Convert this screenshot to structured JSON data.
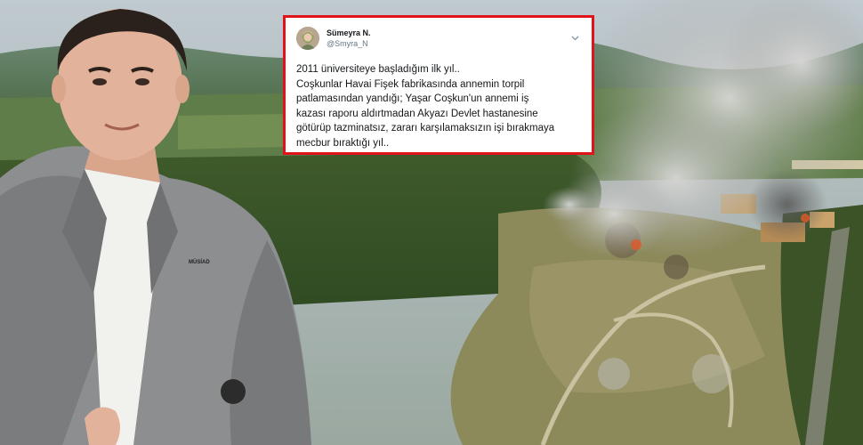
{
  "tweet": {
    "display_name": "Sümeyra N.",
    "handle": "@Smyra_N",
    "lines": [
      "2011 üniversiteye başladığım ilk yıl..",
      "Coşkunlar Havai Fişek fabrikasında annemin torpil",
      "patlamasından yandığı; Yaşar Coşkun'un annemi iş",
      "kazası raporu aldırtmadan Akyazı Devlet hastanesine",
      "götürüp tazminatsız, zararı karşılamaksızın işi bırakmaya",
      "mecbur bıraktığı yıl.."
    ],
    "menu_icon": "chevron-down-icon"
  },
  "person": {
    "lapel_pin_text": "MÜSİAD"
  },
  "colors": {
    "tweet_border": "#e0131a",
    "text": "#14171a",
    "handle": "#657786"
  }
}
